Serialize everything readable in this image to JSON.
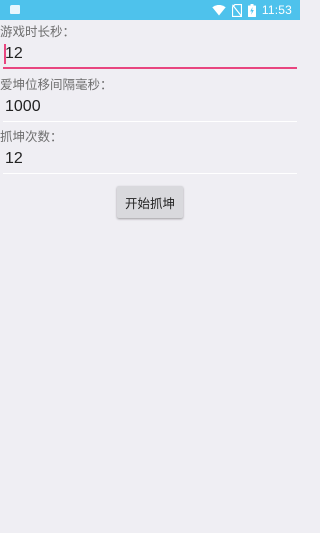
{
  "status_bar": {
    "time": "11:53",
    "icons": [
      "app-notification-icon",
      "wifi-icon",
      "no-sim-icon",
      "battery-icon"
    ],
    "background": "#4ec2ec"
  },
  "form": {
    "fields": [
      {
        "label": "游戏时长秒：",
        "value": "12",
        "focused": true
      },
      {
        "label": "爱坤位移间隔毫秒：",
        "value": "1000",
        "focused": false
      },
      {
        "label": "抓坤次数：",
        "value": "12",
        "focused": false
      }
    ],
    "start_button": "开始抓坤"
  },
  "colors": {
    "accent": "#e8457f",
    "background": "#efeef3"
  }
}
